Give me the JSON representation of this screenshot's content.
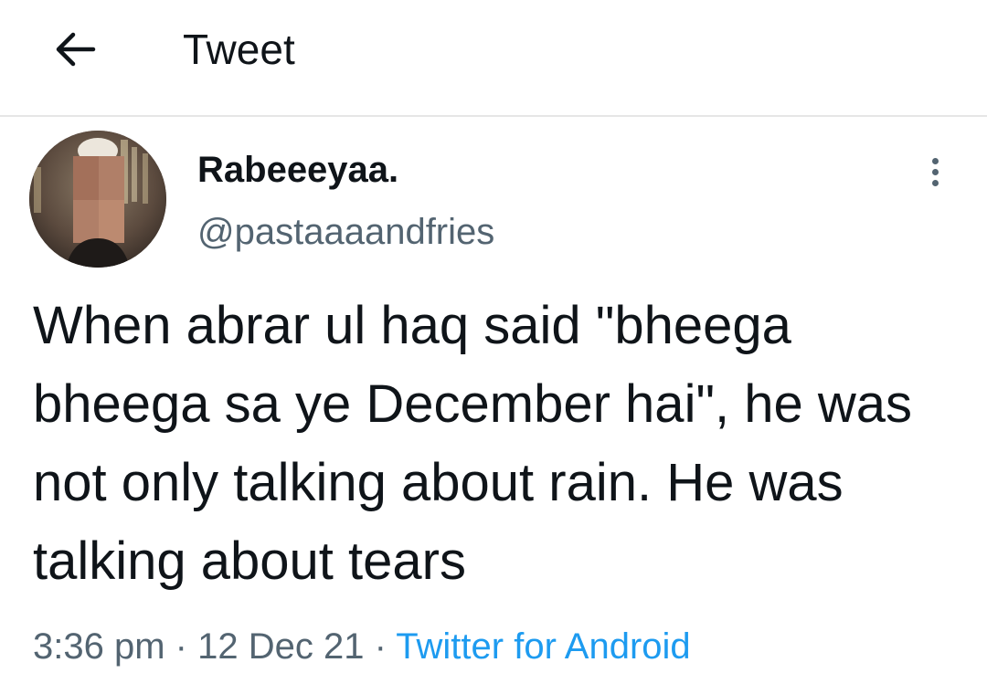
{
  "header": {
    "back_icon": "arrow-left-icon",
    "title": "Tweet"
  },
  "tweet": {
    "avatar_icon": "user-avatar",
    "display_name": "Rabeeeyaa.",
    "handle": "@pastaaaandfries",
    "more_icon": "more-vertical-icon",
    "text": "When abrar ul haq said \"bheega bheega sa ye December hai\", he was not only talking about rain. He was talking about tears",
    "time": "3:36 pm",
    "separator": "·",
    "date": "12 Dec 21",
    "source": "Twitter for Android"
  },
  "colors": {
    "text_primary": "#0f1419",
    "text_secondary": "#536471",
    "accent": "#1d9bf0",
    "divider": "#e6e6e6"
  }
}
